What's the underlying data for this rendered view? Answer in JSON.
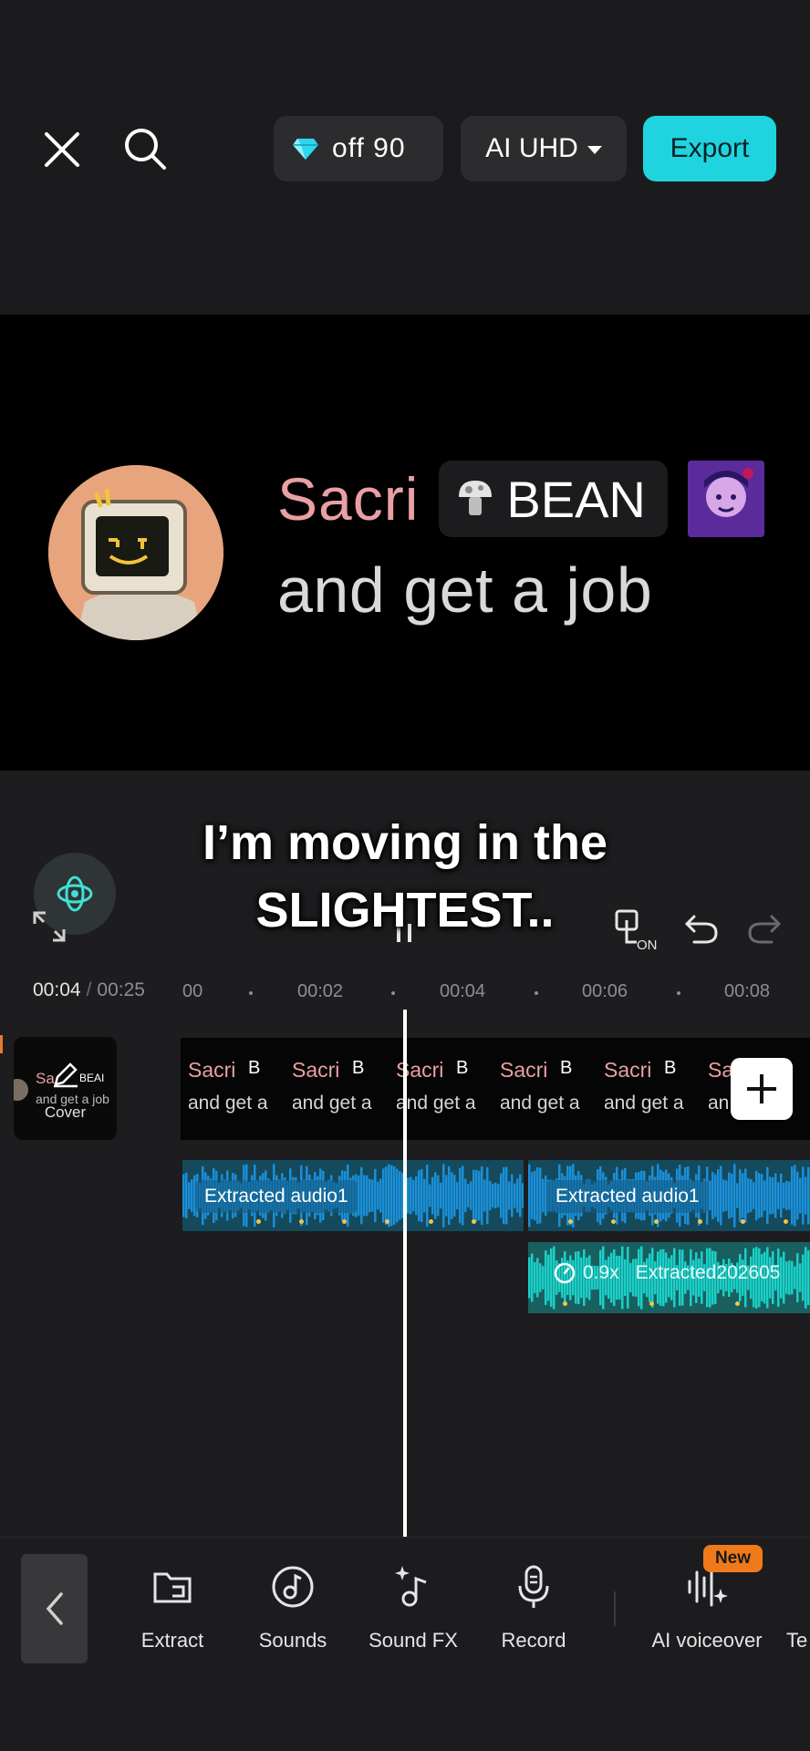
{
  "header": {
    "pro_pill_text": "off   90",
    "resolution_label": "AI UHD",
    "export_label": "Export"
  },
  "preview": {
    "name": "Sacri",
    "badge": "BEAN",
    "message": "and get a job"
  },
  "caption": {
    "line1": "I’m moving in the",
    "line2": "SLIGHTEST.."
  },
  "timeline": {
    "current_time": "00:04",
    "separator": "/",
    "total_time": "00:25",
    "ruler_labels": [
      "00",
      "00:02",
      "00:04",
      "00:06",
      "00:08"
    ],
    "cover_label": "Cover",
    "cover_thumb_name": "Sa",
    "cover_thumb_badge": "BEAI",
    "cover_thumb_message": "and get a job",
    "video_frames": [
      {
        "name": "Sacri",
        "badge": "B",
        "message": "and get a"
      },
      {
        "name": "Sacri",
        "badge": "B",
        "message": "and get a"
      },
      {
        "name": "Sacri",
        "badge": "B",
        "message": "and get a"
      },
      {
        "name": "Sacri",
        "badge": "B",
        "message": "and get a"
      },
      {
        "name": "Sacri",
        "badge": "B",
        "message": "and get a"
      },
      {
        "name": "Sa",
        "badge": "B",
        "message": "an"
      }
    ],
    "audio_clips": [
      {
        "label": "Extracted audio1"
      },
      {
        "label": "Extracted audio1"
      }
    ],
    "sfx_clip": {
      "speed": "0.9x",
      "label": "Extracted202605"
    }
  },
  "toolbar": {
    "items": [
      {
        "label": "Extract",
        "icon": "folder-extract-icon"
      },
      {
        "label": "Sounds",
        "icon": "music-disc-icon"
      },
      {
        "label": "Sound FX",
        "icon": "sparkle-note-icon"
      },
      {
        "label": "Record",
        "icon": "microphone-icon"
      },
      {
        "label": "AI voiceover",
        "icon": "voice-wave-icon"
      },
      {
        "label": "Te",
        "icon": ""
      }
    ],
    "new_badge": "New"
  },
  "colors": {
    "accent": "#1fd4df",
    "audio_clip": "#1a8fd8",
    "sfx_clip": "#1ad0c8",
    "name_pink": "#e8a0a4",
    "new_badge": "#f07a1a"
  }
}
